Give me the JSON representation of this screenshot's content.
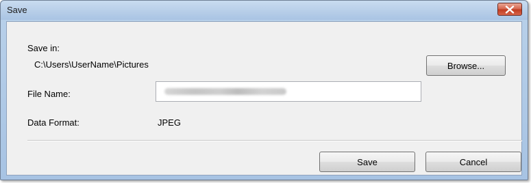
{
  "window": {
    "title": "Save",
    "close_icon": "close-icon"
  },
  "save_in": {
    "label": "Save in:",
    "path": "C:\\Users\\UserName\\Pictures",
    "browse_label": "Browse..."
  },
  "file_name": {
    "label": "File Name:",
    "value": ""
  },
  "data_format": {
    "label": "Data Format:",
    "value": "JPEG"
  },
  "buttons": {
    "save_label": "Save",
    "cancel_label": "Cancel"
  },
  "colors": {
    "close_button": "#c13d22",
    "frame": "#b9d1ea"
  }
}
